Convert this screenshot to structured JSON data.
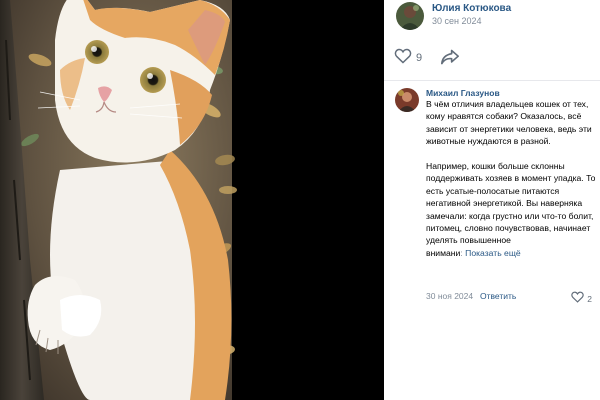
{
  "post": {
    "author": "Юлия Котюкова",
    "date": "30 сен 2024",
    "likes": "9",
    "photo_subject": "orange and white kitten on tree trunk"
  },
  "icons": {
    "like": "heart-icon",
    "share": "share-arrow-icon",
    "comment_like": "heart-icon"
  },
  "comment": {
    "author": "Михаил Глазунов",
    "paragraph1": "В чём отличия владельцев кошек от тех, кому нравятся собаки? Оказалось, всё зависит от энергетики человека, ведь эти животные нуждаются в разной.",
    "paragraph2": "Например, кошки больше склонны поддерживать хозяев в момент упадка. То есть усатые-полосатые питаются негативной энергетикой. Вы наверняка замечали: когда грустно или что-то болит, питомец, словно почувствовав, начинает уделять повышенное",
    "truncated_word": "внимани",
    "show_more": "Показать ещё",
    "date": "30 ноя 2024",
    "reply": "Ответить",
    "likes": "2"
  },
  "colors": {
    "link": "#2a5885",
    "secondary_text": "#818c99",
    "panel_bg": "#ffffff",
    "divider": "#e7e8ec"
  }
}
